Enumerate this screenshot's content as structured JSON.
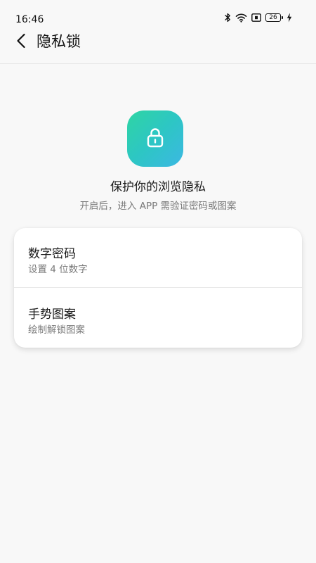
{
  "status_bar": {
    "time": "16:46",
    "battery_level": "26",
    "icons": [
      "bluetooth-icon",
      "wifi-icon",
      "sim-icon",
      "battery-icon",
      "charging-icon"
    ]
  },
  "header": {
    "title": "隐私锁",
    "back_icon": "chevron-left-icon"
  },
  "hero": {
    "icon": "lock-icon",
    "title": "保护你的浏览隐私",
    "subtitle": "开启后，进入 APP 需验证密码或图案",
    "accent_colors": [
      "#2fd5a3",
      "#3cb8e3"
    ]
  },
  "options": [
    {
      "title": "数字密码",
      "description": "设置 4 位数字"
    },
    {
      "title": "手势图案",
      "description": "绘制解锁图案"
    }
  ]
}
